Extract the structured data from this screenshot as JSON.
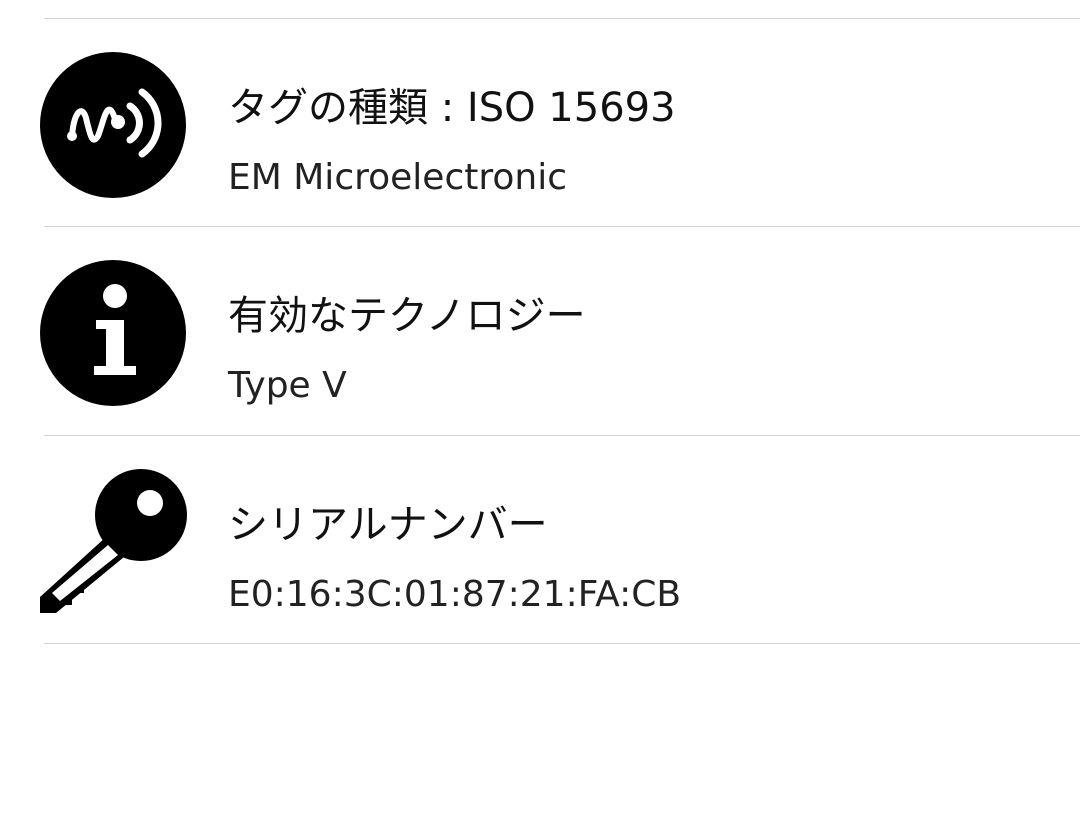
{
  "rows": [
    {
      "title": "タグの種類 : ISO 15693",
      "value": "EM Microelectronic",
      "icon": "nfc-tag-icon"
    },
    {
      "title": "有効なテクノロジー",
      "value": "Type V",
      "icon": "info-icon"
    },
    {
      "title": "シリアルナンバー",
      "value": "E0:16:3C:01:87:21:FA:CB",
      "icon": "key-icon"
    }
  ],
  "colors": {
    "icon": "#000000",
    "divider": "#d6d6d6",
    "background": "#ffffff"
  }
}
